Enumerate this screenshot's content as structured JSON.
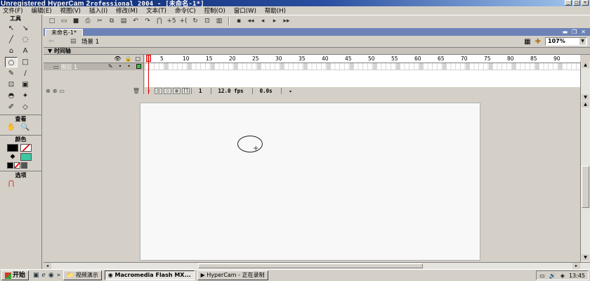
{
  "titlebar": {
    "title_brand": "Unregistered HyperCam 2",
    "title_rest": "rofessional 2004 - [未命名-1*]",
    "min": "_",
    "max": "□",
    "close": "×"
  },
  "menu": [
    "文件(F)",
    "编辑(E)",
    "视图(V)",
    "插入(I)",
    "修改(M)",
    "文本(T)",
    "命令(C)",
    "控制(O)",
    "窗口(W)",
    "帮助(H)"
  ],
  "toolbar_icons": {
    "new": "□",
    "open": "▭",
    "save": "■",
    "print": "⎙",
    "cut": "✂",
    "copy": "⧉",
    "paste": "▤",
    "undo": "↶",
    "redo": "↷",
    "snap": "⋂",
    "smooth": "+5",
    "straighten": "+(",
    "rotate": "↻",
    "scale": "⊡",
    "align": "▥",
    "play": "▪",
    "rewind": "◂◂",
    "back": "◂",
    "forward": "▸",
    "ff": "▸▸"
  },
  "tools": {
    "title": "工具",
    "items": [
      "↖",
      "↘",
      "╱",
      "◌",
      "⌂",
      "A",
      "○",
      "□",
      "✎",
      "/",
      "⊡",
      "▣",
      "◓",
      "✦",
      "✐",
      "◇"
    ],
    "view_title": "查看",
    "view_items": [
      "✋",
      "🔍"
    ],
    "color_title": "颜色",
    "fill_color": "#3cc8a0",
    "options_title": "选项",
    "option_icon": "⋂"
  },
  "document": {
    "tab": "未命名-1*",
    "scene_label": "场景 1",
    "zoom": "107%",
    "timeline_title": "时间轴",
    "layer_name": "图层 1",
    "ruler": [
      "1",
      "5",
      "10",
      "15",
      "20",
      "25",
      "30",
      "35",
      "40",
      "45",
      "50",
      "55",
      "60",
      "65",
      "70",
      "75",
      "80",
      "85",
      "90"
    ],
    "current_frame": "1",
    "fps": "12.0 fps",
    "elapsed": "0.0s"
  },
  "taskbar": {
    "start": "开始",
    "tasks": [
      {
        "label": "视频演示",
        "active": false
      },
      {
        "label": "Macromedia Flash MX...",
        "active": true
      },
      {
        "label": "HyperCam - 正在录制",
        "active": false
      }
    ],
    "clock": "13:45"
  }
}
